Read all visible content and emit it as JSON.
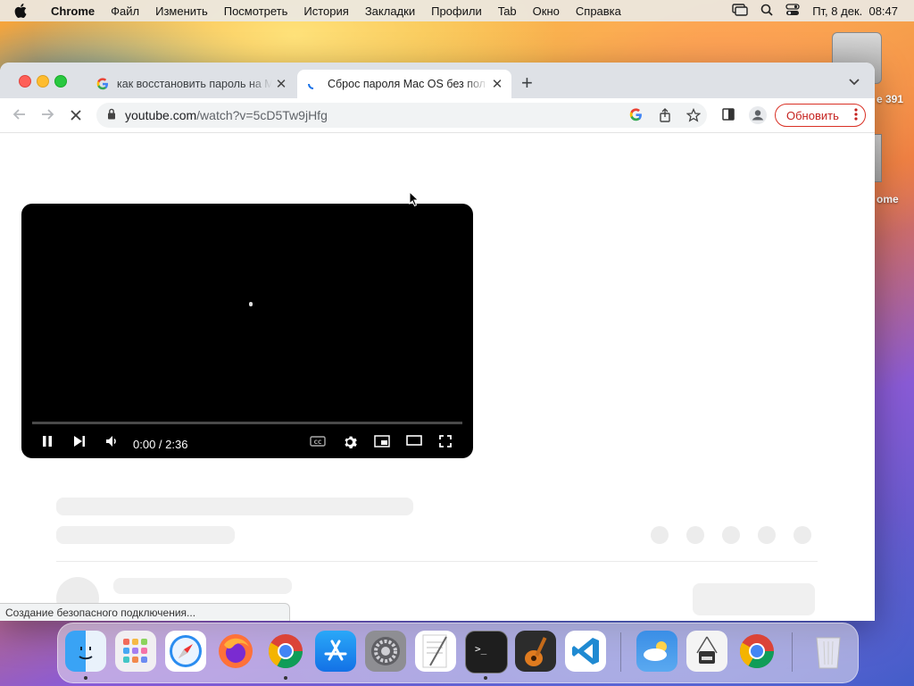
{
  "menubar": {
    "app": "Chrome",
    "items": [
      "Файл",
      "Изменить",
      "Посмотреть",
      "История",
      "Закладки",
      "Профили",
      "Tab",
      "Окно",
      "Справка"
    ],
    "clock": "Пт, 8 дек.  08:47"
  },
  "desktop": {
    "label_top": "e 391",
    "label_bottom": "ome"
  },
  "tabs": [
    {
      "title": "как восстановить пароль на Mac",
      "favicon": "google-icon",
      "active": false
    },
    {
      "title": "Сброс пароля Mac OS без пол",
      "favicon": "loading-spinner-icon",
      "active": true
    }
  ],
  "toolbar": {
    "url_host": "youtube.com",
    "url_path": "/watch?v=5cD5Tw9jHfg",
    "update_label": "Обновить"
  },
  "player": {
    "time": "0:00 / 2:36",
    "progress": 0.0
  },
  "status_bar": "Создание безопасного подключения...",
  "dock": [
    "Finder",
    "Launchpad",
    "Safari",
    "Firefox",
    "Chrome",
    "App Store",
    "System Settings",
    "TextEdit",
    "Terminal",
    "GarageBand",
    "Visual Studio Code",
    "Weather",
    "Printer",
    "Chrome",
    "Trash"
  ]
}
